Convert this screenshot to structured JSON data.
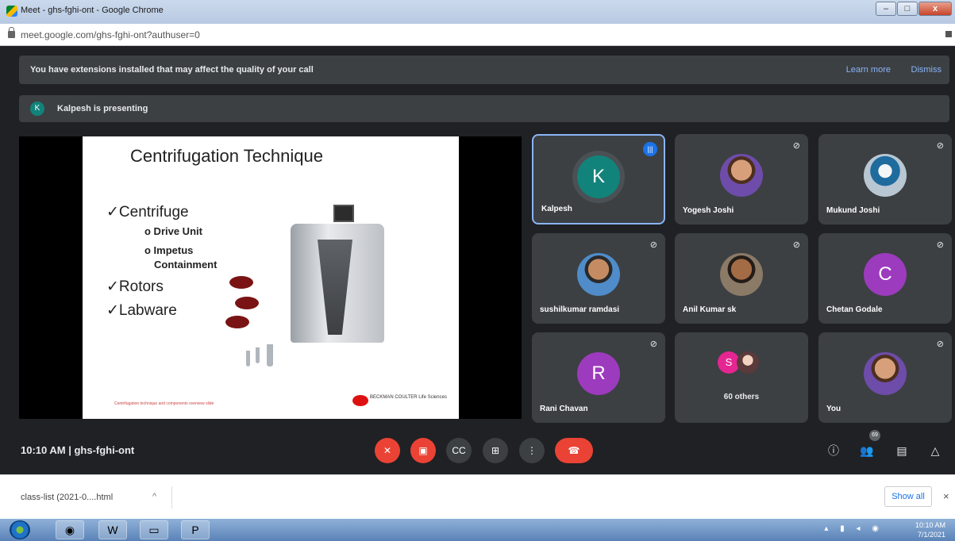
{
  "browser": {
    "window_title": "Meet - ghs-fghi-ont - Google Chrome",
    "url": "meet.google.com/ghs-fghi-ont?authuser=0",
    "window_controls": [
      "–",
      "□",
      "x"
    ]
  },
  "notice": {
    "message": "You have extensions installed that may affect the quality of your call",
    "learn_more": "Learn more",
    "dismiss": "Dismiss"
  },
  "presenting": {
    "avatar_letter": "K",
    "label": "Kalpesh is presenting"
  },
  "slide": {
    "title": "Centrifugation Technique",
    "bullets": [
      "✓Centrifuge",
      "✓Rotors",
      "✓Labware"
    ],
    "sub_bullets": [
      "o Drive Unit",
      "o Impetus",
      "Containment"
    ],
    "logo_text": "BECKMAN COULTER Life Sciences",
    "footnote": "Centrifugation technique and components overview slide"
  },
  "participants": [
    {
      "name": "Kalpesh",
      "avatar": "K",
      "type": "letter",
      "speaking": true
    },
    {
      "name": "Yogesh Joshi",
      "type": "photo",
      "muted": true
    },
    {
      "name": "Mukund Joshi",
      "type": "photo",
      "muted": true
    },
    {
      "name": "sushilkumar ramdasi",
      "type": "photo",
      "muted": true
    },
    {
      "name": "Anil Kumar sk",
      "type": "photo",
      "muted": true
    },
    {
      "name": "Chetan Godale",
      "avatar": "C",
      "type": "letter",
      "muted": true
    },
    {
      "name": "Rani Chavan",
      "avatar": "R",
      "type": "letter",
      "muted": true
    },
    {
      "name": "60 others",
      "avatar": "S",
      "type": "group"
    },
    {
      "name": "You",
      "type": "photo",
      "muted": true
    }
  ],
  "controls": {
    "meeting_info": "10:10 AM  |  ghs-fghi-ont",
    "participant_count": "69",
    "icons": [
      "mic-off-icon",
      "camera-off-icon",
      "captions-icon",
      "present-icon",
      "more-icon",
      "hangup-icon",
      "info-icon",
      "people-icon",
      "chat-icon",
      "activities-icon"
    ],
    "accent_red": "#ea4335",
    "accent_blue": "#8ab4f8"
  },
  "downloads": {
    "file": "class-list (2021-0....html",
    "show_all": "Show all",
    "close": "×"
  },
  "taskbar": {
    "time": "10:10 AM",
    "date": "7/1/2021"
  }
}
